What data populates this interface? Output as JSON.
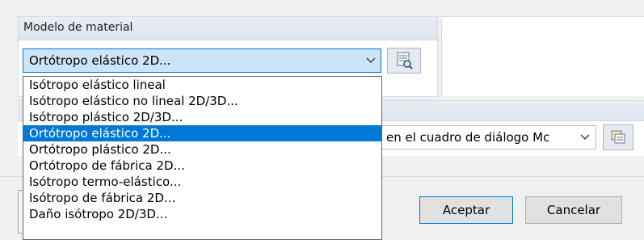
{
  "material_model": {
    "section_title": "Modelo de material",
    "selected": "Ortótropo elástico 2D...",
    "options": [
      "Isótropo elástico lineal",
      "Isótropo elástico no lineal 2D/3D...",
      "Isótropo plástico 2D/3D...",
      "Ortótropo elástico 2D...",
      "Ortótropo plástico 2D...",
      "Ortótropo de fábrica 2D...",
      "Isótropo termo-elástico...",
      "Isótropo de fábrica 2D...",
      "Daño isótropo 2D/3D..."
    ],
    "selected_index": 3
  },
  "secondary_combo": {
    "value": "en el cuadro de diálogo Mc"
  },
  "buttons": {
    "ok": "Aceptar",
    "cancel": "Cancelar"
  },
  "icons": {
    "library": "material-library-icon",
    "copy": "copy-icon",
    "dropdown_arrow": "chevron-down-icon"
  },
  "colors": {
    "selection": "#0078d7",
    "combo_focus_bg": "#cce4f7",
    "header_bg": "#dfe6ef"
  }
}
